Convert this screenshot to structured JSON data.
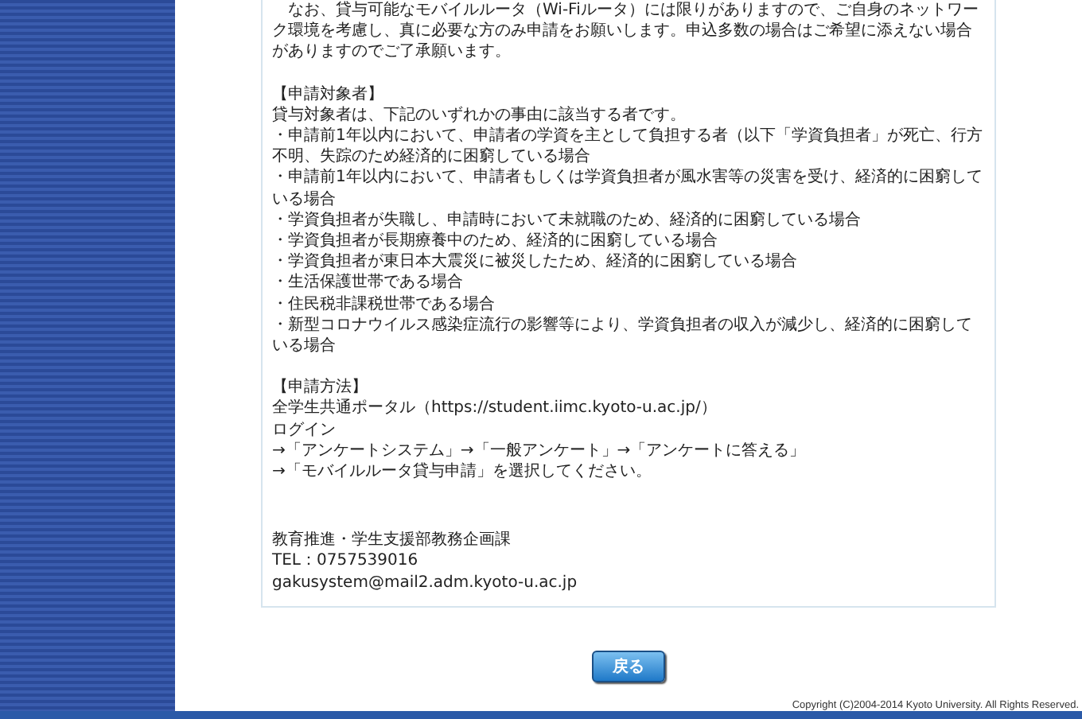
{
  "intro_paragraph": "　なお、貸与可能なモバイルルータ（Wi-Fiルータ）には限りがありますので、ご自身のネットワーク環境を考慮し、真に必要な方のみ申請をお願いします。申込多数の場合はご希望に添えない場合がありますのでご了承願います。",
  "sections": [
    {
      "heading": "【申請対象者】",
      "lines": [
        "貸与対象者は、下記のいずれかの事由に該当する者です。",
        "・申請前1年以内において、申請者の学資を主として負担する者（以下「学資負担者」が死亡、行方不明、失踪のため経済的に困窮している場合",
        "・申請前1年以内において、申請者もしくは学資負担者が風水害等の災害を受け、経済的に困窮している場合",
        "・学資負担者が失職し、申請時において未就職のため、経済的に困窮している場合",
        "・学資負担者が長期療養中のため、経済的に困窮している場合",
        "・学資負担者が東日本大震災に被災したため、経済的に困窮している場合",
        "・生活保護世帯である場合",
        "・住民税非課税世帯である場合",
        "・新型コロナウイルス感染症流行の影響等により、学資負担者の収入が減少し、経済的に困窮している場合"
      ]
    },
    {
      "heading": "【申請方法】",
      "lines": [
        "全学生共通ポータル（https://student.iimc.kyoto-u.ac.jp/）",
        "ログイン",
        "→「アンケートシステム」→「一般アンケート」→「アンケートに答える」",
        "→「モバイルルータ貸与申請」を選択してください。"
      ]
    }
  ],
  "contact": [
    "教育推進・学生支援部教務企画課",
    "TEL：0757539016",
    "gakusystem@mail2.adm.kyoto-u.ac.jp"
  ],
  "back_button": "戻る",
  "copyright": "Copyright (C)2004-2014 Kyoto University. All Rights Reserved."
}
